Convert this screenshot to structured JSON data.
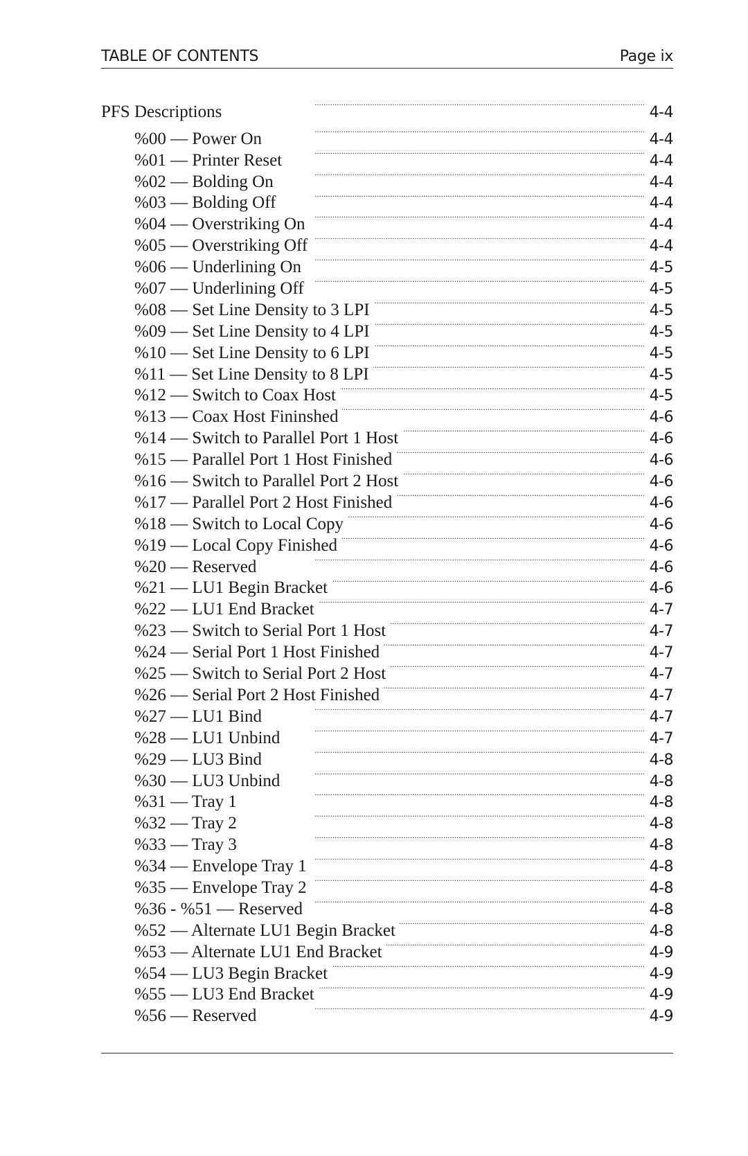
{
  "header": {
    "title": "TABLE OF CONTENTS",
    "page_label": "Page ix"
  },
  "toc": {
    "section": {
      "label": "PFS Descriptions",
      "page": "4-4"
    },
    "entries": [
      {
        "label": "%00 — Power On",
        "page": "4-4"
      },
      {
        "label": "%01 — Printer Reset",
        "page": "4-4"
      },
      {
        "label": "%02 — Bolding On",
        "page": "4-4"
      },
      {
        "label": "%03 — Bolding Off",
        "page": "4-4"
      },
      {
        "label": "%04 — Overstriking On",
        "page": "4-4"
      },
      {
        "label": "%05 — Overstriking Off",
        "page": "4-4"
      },
      {
        "label": "%06 — Underlining On",
        "page": "4-5"
      },
      {
        "label": "%07 — Underlining Off",
        "page": "4-5"
      },
      {
        "label": "%08 — Set Line Density to 3 LPI",
        "page": "4-5"
      },
      {
        "label": "%09 — Set Line Density to 4 LPI",
        "page": "4-5"
      },
      {
        "label": "%10 — Set Line Density to 6 LPI",
        "page": "4-5"
      },
      {
        "label": "%11 — Set Line Density to 8 LPI",
        "page": "4-5"
      },
      {
        "label": "%12 — Switch to Coax Host",
        "page": "4-5"
      },
      {
        "label": "%13 — Coax Host Fininshed",
        "page": "4-6"
      },
      {
        "label": "%14 — Switch to Parallel Port 1 Host",
        "page": "4-6"
      },
      {
        "label": "%15 — Parallel Port 1 Host Finished",
        "page": "4-6"
      },
      {
        "label": "%16 — Switch to Parallel Port 2 Host",
        "page": "4-6"
      },
      {
        "label": "%17 — Parallel Port 2 Host Finished",
        "page": "4-6"
      },
      {
        "label": "%18 — Switch to Local Copy",
        "page": "4-6"
      },
      {
        "label": "%19 — Local Copy Finished",
        "page": "4-6"
      },
      {
        "label": "%20 — Reserved",
        "page": "4-6"
      },
      {
        "label": "%21 — LU1 Begin Bracket",
        "page": "4-6"
      },
      {
        "label": "%22 — LU1 End Bracket",
        "page": "4-7"
      },
      {
        "label": "%23 — Switch to Serial Port 1 Host",
        "page": "4-7"
      },
      {
        "label": "%24 — Serial Port 1 Host Finished",
        "page": "4-7"
      },
      {
        "label": "%25 — Switch to Serial Port 2 Host",
        "page": "4-7"
      },
      {
        "label": "%26 — Serial Port 2 Host Finished",
        "page": "4-7"
      },
      {
        "label": "%27 — LU1 Bind",
        "page": "4-7"
      },
      {
        "label": "%28 — LU1 Unbind",
        "page": "4-7"
      },
      {
        "label": "%29 — LU3 Bind",
        "page": "4-8"
      },
      {
        "label": "%30 — LU3 Unbind",
        "page": "4-8"
      },
      {
        "label": "%31 — Tray 1",
        "page": "4-8"
      },
      {
        "label": "%32 — Tray 2",
        "page": "4-8"
      },
      {
        "label": "%33 — Tray 3",
        "page": "4-8"
      },
      {
        "label": "%34 — Envelope Tray 1",
        "page": "4-8"
      },
      {
        "label": "%35 — Envelope Tray 2",
        "page": "4-8"
      },
      {
        "label": "%36 - %51 — Reserved",
        "page": "4-8"
      },
      {
        "label": "%52 — Alternate LU1 Begin Bracket",
        "page": "4-8"
      },
      {
        "label": "%53 — Alternate LU1 End Bracket",
        "page": "4-9"
      },
      {
        "label": "%54 — LU3 Begin Bracket",
        "page": "4-9"
      },
      {
        "label": "%55 — LU3 End Bracket",
        "page": "4-9"
      },
      {
        "label": "%56 — Reserved",
        "page": "4-9"
      }
    ]
  }
}
